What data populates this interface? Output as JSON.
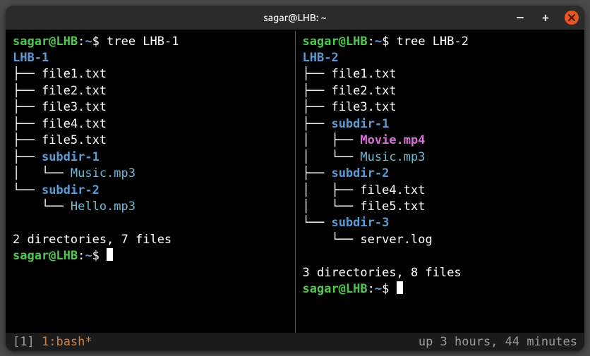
{
  "window": {
    "title": "sagar@LHB: ~"
  },
  "prompt": {
    "user_host": "sagar@LHB",
    "sep": ":",
    "path": "~",
    "sigil": "$"
  },
  "left": {
    "command": "tree LHB-1",
    "root": "LHB-1",
    "lines": [
      {
        "prefix": "├── ",
        "name": "file1.txt",
        "cls": "c-white"
      },
      {
        "prefix": "├── ",
        "name": "file2.txt",
        "cls": "c-white"
      },
      {
        "prefix": "├── ",
        "name": "file3.txt",
        "cls": "c-white"
      },
      {
        "prefix": "├── ",
        "name": "file4.txt",
        "cls": "c-white"
      },
      {
        "prefix": "├── ",
        "name": "file5.txt",
        "cls": "c-white"
      },
      {
        "prefix": "├── ",
        "name": "subdir-1",
        "cls": "c-blue"
      },
      {
        "prefix": "│   └── ",
        "name": "Music.mp3",
        "cls": "c-lblue"
      },
      {
        "prefix": "└── ",
        "name": "subdir-2",
        "cls": "c-blue"
      },
      {
        "prefix": "    └── ",
        "name": "Hello.mp3",
        "cls": "c-lblue"
      }
    ],
    "summary": "2 directories, 7 files"
  },
  "right": {
    "command": "tree LHB-2",
    "root": "LHB-2",
    "lines": [
      {
        "prefix": "├── ",
        "name": "file1.txt",
        "cls": "c-white"
      },
      {
        "prefix": "├── ",
        "name": "file2.txt",
        "cls": "c-white"
      },
      {
        "prefix": "├── ",
        "name": "file3.txt",
        "cls": "c-white"
      },
      {
        "prefix": "├── ",
        "name": "subdir-1",
        "cls": "c-blue"
      },
      {
        "prefix": "│   ├── ",
        "name": "Movie.mp4",
        "cls": "c-mag"
      },
      {
        "prefix": "│   └── ",
        "name": "Music.mp3",
        "cls": "c-lblue"
      },
      {
        "prefix": "├── ",
        "name": "subdir-2",
        "cls": "c-blue"
      },
      {
        "prefix": "│   ├── ",
        "name": "file4.txt",
        "cls": "c-white"
      },
      {
        "prefix": "│   └── ",
        "name": "file5.txt",
        "cls": "c-white"
      },
      {
        "prefix": "└── ",
        "name": "subdir-3",
        "cls": "c-blue"
      },
      {
        "prefix": "    └── ",
        "name": "server.log",
        "cls": "c-white"
      }
    ],
    "summary": "3 directories, 8 files"
  },
  "status": {
    "left_bracket_open": "[",
    "left_index": "1",
    "left_bracket_close": "] ",
    "left_active": "1:bash*",
    "right": "up 3 hours, 44 minutes"
  }
}
